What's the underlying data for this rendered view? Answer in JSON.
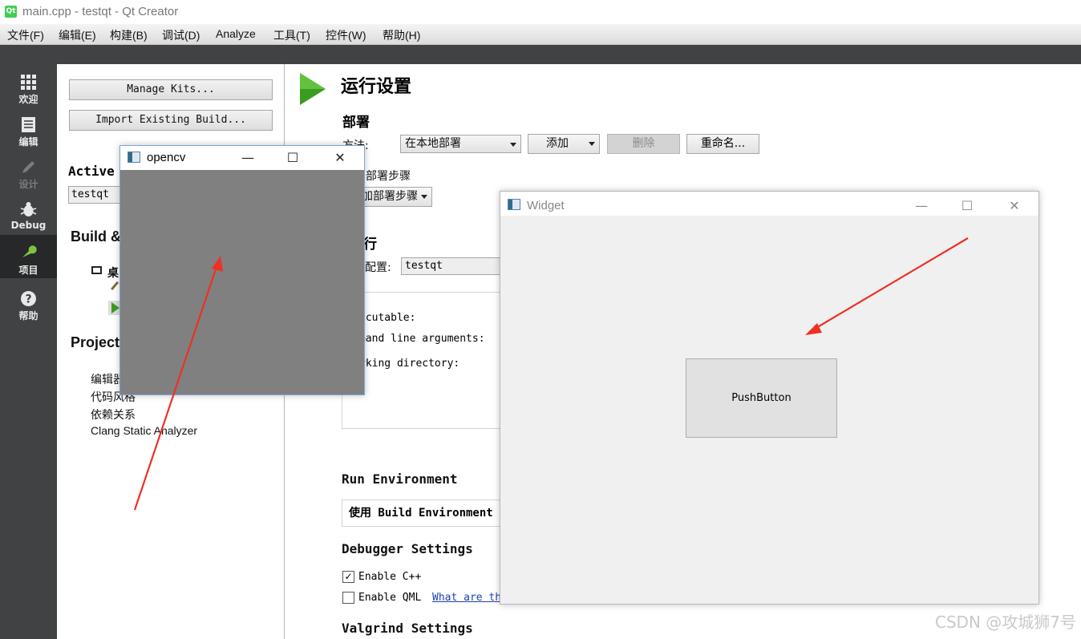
{
  "window": {
    "title": "main.cpp - testqt - Qt Creator",
    "logo_text": "Qt"
  },
  "menu": [
    "文件(F)",
    "编辑(E)",
    "构建(B)",
    "调试(D)",
    "Analyze",
    "工具(T)",
    "控件(W)",
    "帮助(H)"
  ],
  "modes": [
    {
      "label": "欢迎",
      "icon": "grid-icon"
    },
    {
      "label": "编辑",
      "icon": "document-icon"
    },
    {
      "label": "设计",
      "icon": "pencil-icon"
    },
    {
      "label": "Debug",
      "icon": "bug-icon"
    },
    {
      "label": "项目",
      "icon": "wrench-icon"
    },
    {
      "label": "帮助",
      "icon": "help-icon"
    }
  ],
  "left_panel": {
    "manage_kits": "Manage Kits...",
    "import_build": "Import Existing Build...",
    "active_heading": "Active",
    "active_value": "testqt",
    "build_heading": "Build &",
    "kit_item": "桌",
    "projects_heading": "Project",
    "project_items": [
      "编辑器",
      "代码风格",
      "依赖关系",
      "Clang Static Analyzer"
    ]
  },
  "run_settings": {
    "title": "运行设置",
    "deploy_heading": "部署",
    "method_label": "方法:",
    "method_value": "在本地部署",
    "add_button": "添加",
    "delete_button": "删除",
    "rename_button": "重命名...",
    "deploy_steps_label": "部署步骤",
    "add_deploy_step": "加部署步骤",
    "run_heading": "行",
    "run_config_label": "配置:",
    "run_config_value": "testqt",
    "executable_label": "ecutable:",
    "cmd_args_label": "mand line arguments:",
    "working_dir_label": "rking directory:",
    "run_env_heading": "Run Environment",
    "run_env_value": "使用 Build Environment",
    "debugger_heading": "Debugger Settings",
    "enable_cpp": "Enable C++",
    "enable_cpp_checked": true,
    "enable_qml": "Enable QML",
    "enable_qml_checked": false,
    "what_link": "What are th",
    "valgrind_heading": "Valgrind Settings"
  },
  "opencv_window": {
    "title": "opencv",
    "minimize": "—",
    "maximize": "☐",
    "close": "✕",
    "bg_color": "#808080"
  },
  "widget_window": {
    "title": "Widget",
    "minimize": "—",
    "maximize": "☐",
    "close": "✕",
    "push_button": "PushButton"
  },
  "watermark": "CSDN @攻城狮7号",
  "colors": {
    "arrow": "#ee3124",
    "mode_bar": "#404244",
    "run_icon": "#3a9c20"
  }
}
